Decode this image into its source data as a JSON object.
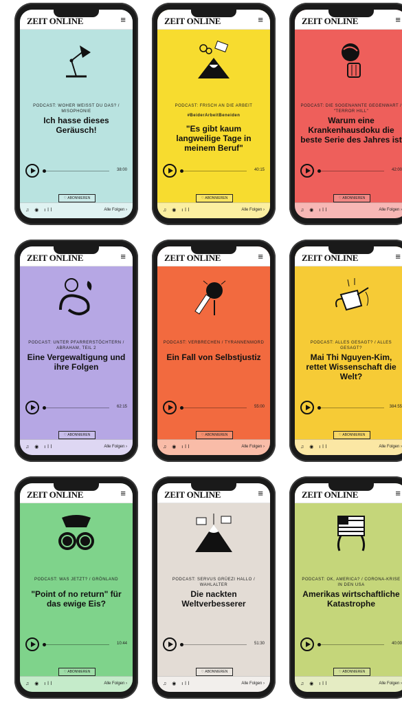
{
  "logo": "ZEIT ONLINE",
  "menu_icon": "hamburger-icon",
  "footer": {
    "icons": "♫ ◉ ıll",
    "all_episodes": "Alle Folgen ›"
  },
  "subscribe_label": "♡ ABONNIEREN",
  "cards": [
    {
      "bg": "#b9e3e0",
      "kicker": "PODCAST: WOHER WEISST DU DAS? / MISOPHONIE",
      "title": "Ich hasse dieses Geräusch!",
      "duration": "38:00",
      "illus": "desk-lamp-icon"
    },
    {
      "bg": "#f7dc2f",
      "kicker": "Podcast: Frisch an die Arbeit",
      "kicker2": "#BeiderArbeitBeneiden",
      "title": "\"Es gibt kaum langweilige Tage in meinem Beruf\"",
      "duration": "40:15",
      "illus": "volcano-icon"
    },
    {
      "bg": "#ee5f5b",
      "kicker": "PODCAST: DIE SOGENANNTE GEGENWART / \"TERROR HILL\"",
      "title": "Warum eine Krankenhausdoku die beste Serie des Jahres ist",
      "duration": "42:00",
      "illus": "globe-hand-icon"
    },
    {
      "bg": "#b6a7e4",
      "kicker": "PODCAST: UNTER PFARRERSTÖCHTERN / ABRAHAM, TEIL 2",
      "title": "Eine Vergewaltigung und ihre Folgen",
      "duration": "62:15",
      "illus": "serpent-icon"
    },
    {
      "bg": "#f26a3f",
      "kicker": "PODCAST: VERBRECHEN / TYRANNENMORD",
      "title": "Ein Fall von Selbstjustiz",
      "duration": "55:00",
      "illus": "dagger-icon"
    },
    {
      "bg": "#f6cb36",
      "kicker": "PODCAST: ALLES GESAGT? / ALLES GESAGT?",
      "title": "Mai Thi Nguyen-Kim, rettet Wissenschaft die Welt?",
      "duration": "384:55",
      "illus": "watering-can-icon"
    },
    {
      "bg": "#7fd38b",
      "kicker": "PODCAST: WAS JETZT? / GRÖNLAND",
      "title": "\"Point of no return\" für das ewige Eis?",
      "duration": "10:44",
      "illus": "binoculars-icon"
    },
    {
      "bg": "#e3dcd5",
      "kicker": "PODCAST: SERVUS GRÜEZI HALLO / WAHLALTER",
      "title": "Die nackten Weltverbesserer",
      "duration": "51:30",
      "illus": "mountain-flags-icon"
    },
    {
      "bg": "#c5d67a",
      "kicker": "PODCAST: OK, AMERICA? / CORONA-KRISE IN DEN USA",
      "title": "Amerikas wirtschaftliche Katastrophe",
      "duration": "40:00",
      "illus": "flag-character-icon"
    }
  ]
}
